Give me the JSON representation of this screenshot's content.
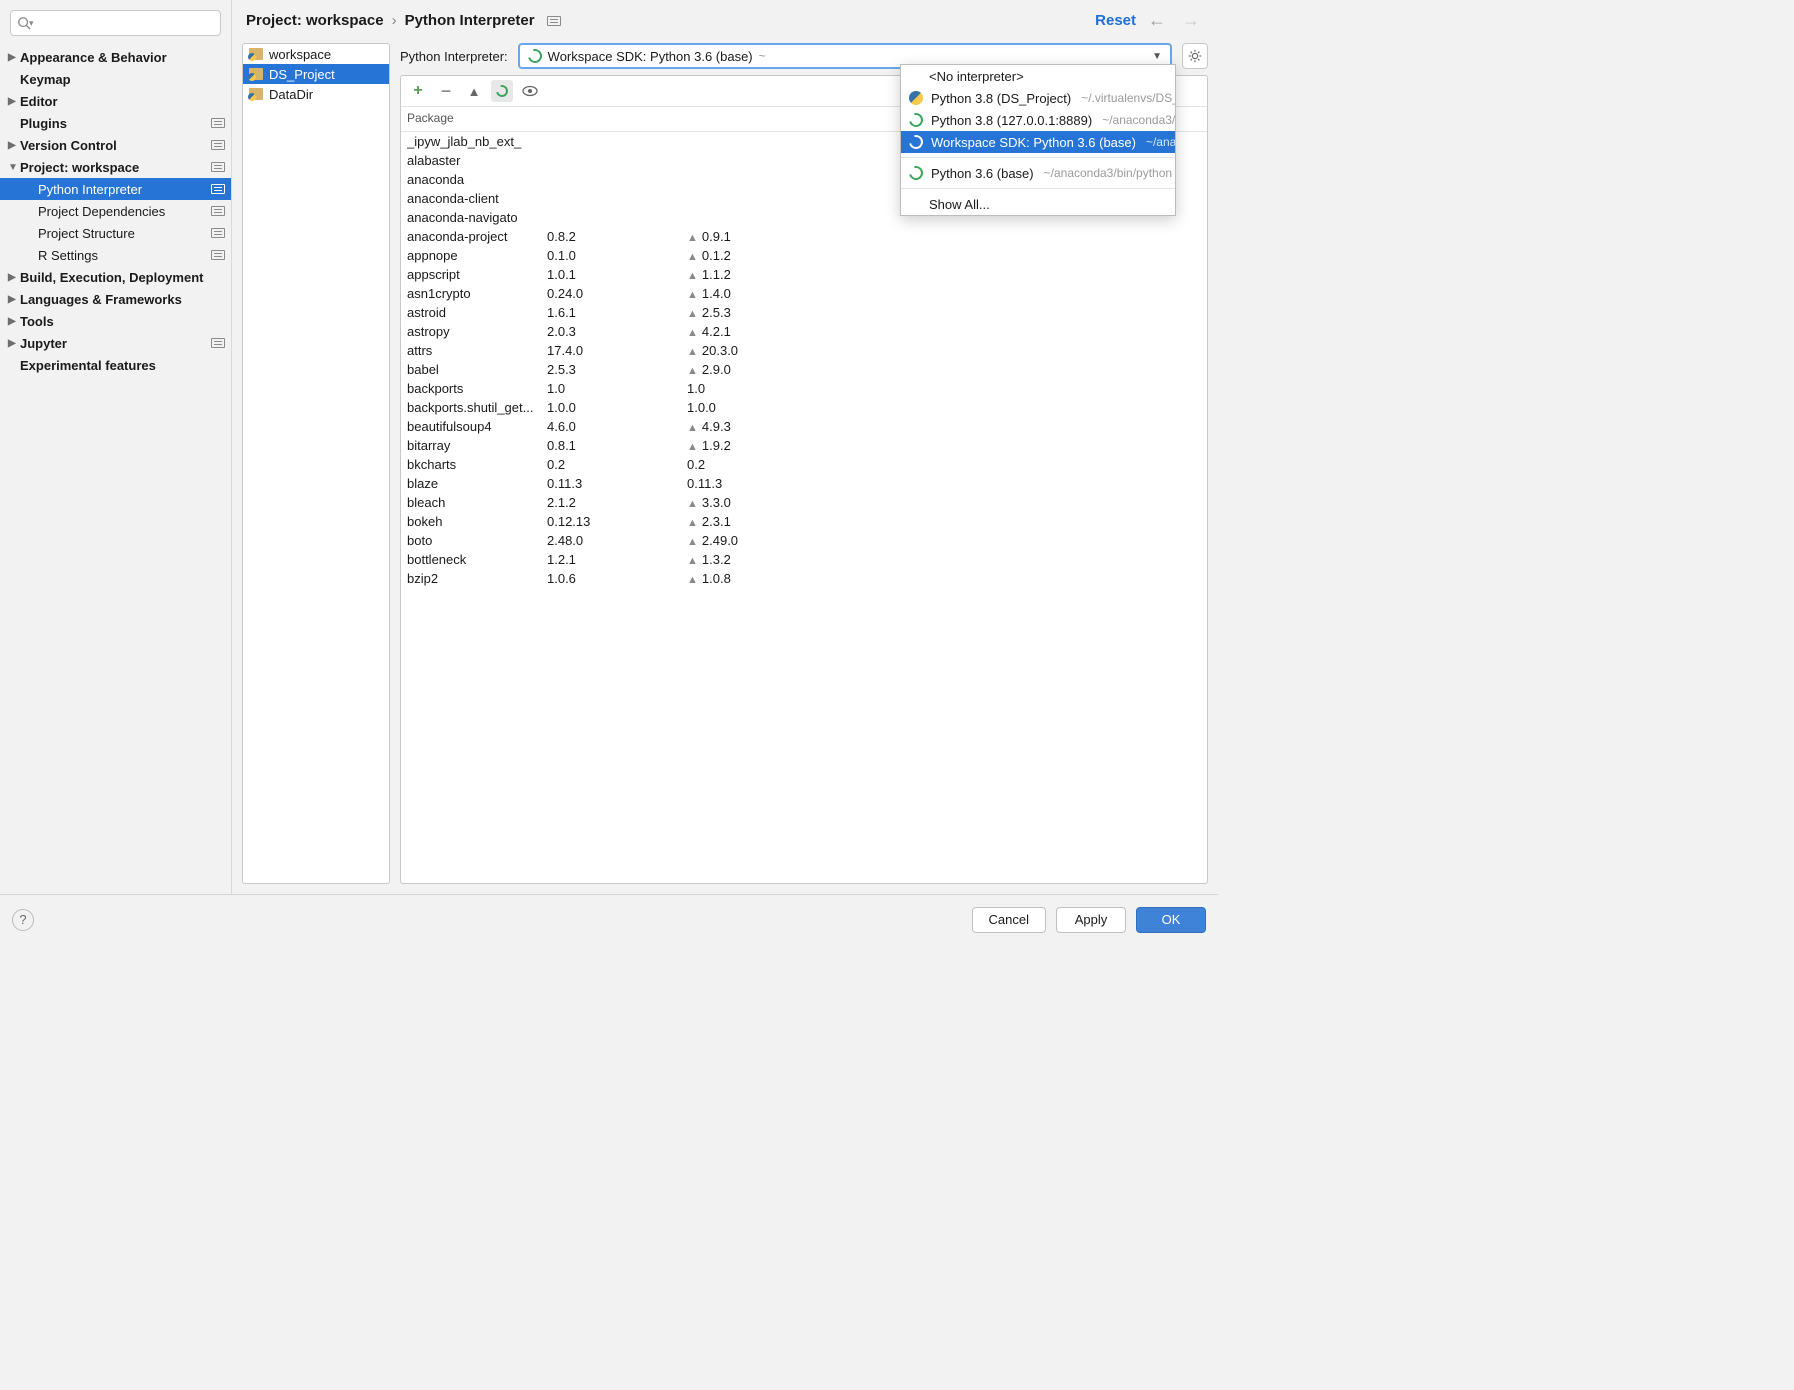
{
  "search": {
    "placeholder": ""
  },
  "sidebar": {
    "items": [
      {
        "label": "Appearance & Behavior",
        "bold": true,
        "chevron": "right"
      },
      {
        "label": "Keymap",
        "bold": true
      },
      {
        "label": "Editor",
        "bold": true,
        "chevron": "right"
      },
      {
        "label": "Plugins",
        "bold": true,
        "badge": true
      },
      {
        "label": "Version Control",
        "bold": true,
        "chevron": "right",
        "badge": true
      },
      {
        "label": "Project: workspace",
        "bold": true,
        "chevron": "down",
        "badge": true
      },
      {
        "label": "Python Interpreter",
        "child": true,
        "selected": true,
        "badge": true
      },
      {
        "label": "Project Dependencies",
        "child": true,
        "badge": true
      },
      {
        "label": "Project Structure",
        "child": true,
        "badge": true
      },
      {
        "label": "R Settings",
        "child": true,
        "badge": true
      },
      {
        "label": "Build, Execution, Deployment",
        "bold": true,
        "chevron": "right"
      },
      {
        "label": "Languages & Frameworks",
        "bold": true,
        "chevron": "right"
      },
      {
        "label": "Tools",
        "bold": true,
        "chevron": "right"
      },
      {
        "label": "Jupyter",
        "bold": true,
        "chevron": "right",
        "badge": true
      },
      {
        "label": "Experimental features",
        "bold": true
      }
    ]
  },
  "breadcrumb": {
    "project": "Project: workspace",
    "leaf": "Python Interpreter",
    "reset": "Reset"
  },
  "project_tree": [
    {
      "label": "workspace"
    },
    {
      "label": "DS_Project",
      "selected": true
    },
    {
      "label": "DataDir"
    }
  ],
  "interpreter": {
    "label": "Python Interpreter:",
    "selected": "Workspace SDK: Python 3.6 (base)",
    "selected_path": "~"
  },
  "dropdown": {
    "no_interpreter": "<No interpreter>",
    "items": [
      {
        "icon": "python",
        "label": "Python 3.8 (DS_Project)",
        "path": "~/.virtualenvs/DS_"
      },
      {
        "icon": "conda",
        "label": "Python 3.8 (127.0.0.1:8889)",
        "path": "~/anaconda3/"
      },
      {
        "icon": "conda",
        "label": "Workspace SDK: Python 3.6 (base)",
        "path": "~/ana",
        "selected": true
      }
    ],
    "extra": {
      "icon": "conda",
      "label": "Python 3.6 (base)",
      "path": "~/anaconda3/bin/python"
    },
    "show_all": "Show All..."
  },
  "packages": {
    "header": "Package",
    "rows": [
      {
        "name": "_ipyw_jlab_nb_ext_",
        "ver": "",
        "latest": "",
        "up": false
      },
      {
        "name": "alabaster",
        "ver": "",
        "latest": "",
        "up": false
      },
      {
        "name": "anaconda",
        "ver": "",
        "latest": "",
        "up": false
      },
      {
        "name": "anaconda-client",
        "ver": "",
        "latest": "",
        "up": false
      },
      {
        "name": "anaconda-navigato",
        "ver": "",
        "latest": "",
        "up": false
      },
      {
        "name": "anaconda-project",
        "ver": "0.8.2",
        "latest": "0.9.1",
        "up": true
      },
      {
        "name": "appnope",
        "ver": "0.1.0",
        "latest": "0.1.2",
        "up": true
      },
      {
        "name": "appscript",
        "ver": "1.0.1",
        "latest": "1.1.2",
        "up": true
      },
      {
        "name": "asn1crypto",
        "ver": "0.24.0",
        "latest": "1.4.0",
        "up": true
      },
      {
        "name": "astroid",
        "ver": "1.6.1",
        "latest": "2.5.3",
        "up": true
      },
      {
        "name": "astropy",
        "ver": "2.0.3",
        "latest": "4.2.1",
        "up": true
      },
      {
        "name": "attrs",
        "ver": "17.4.0",
        "latest": "20.3.0",
        "up": true
      },
      {
        "name": "babel",
        "ver": "2.5.3",
        "latest": "2.9.0",
        "up": true
      },
      {
        "name": "backports",
        "ver": "1.0",
        "latest": "1.0",
        "up": false
      },
      {
        "name": "backports.shutil_get...",
        "ver": "1.0.0",
        "latest": "1.0.0",
        "up": false
      },
      {
        "name": "beautifulsoup4",
        "ver": "4.6.0",
        "latest": "4.9.3",
        "up": true
      },
      {
        "name": "bitarray",
        "ver": "0.8.1",
        "latest": "1.9.2",
        "up": true
      },
      {
        "name": "bkcharts",
        "ver": "0.2",
        "latest": "0.2",
        "up": false
      },
      {
        "name": "blaze",
        "ver": "0.11.3",
        "latest": "0.11.3",
        "up": false
      },
      {
        "name": "bleach",
        "ver": "2.1.2",
        "latest": "3.3.0",
        "up": true
      },
      {
        "name": "bokeh",
        "ver": "0.12.13",
        "latest": "2.3.1",
        "up": true
      },
      {
        "name": "boto",
        "ver": "2.48.0",
        "latest": "2.49.0",
        "up": true
      },
      {
        "name": "bottleneck",
        "ver": "1.2.1",
        "latest": "1.3.2",
        "up": true
      },
      {
        "name": "bzip2",
        "ver": "1.0.6",
        "latest": "1.0.8",
        "up": true
      }
    ]
  },
  "footer": {
    "cancel": "Cancel",
    "apply": "Apply",
    "ok": "OK"
  }
}
